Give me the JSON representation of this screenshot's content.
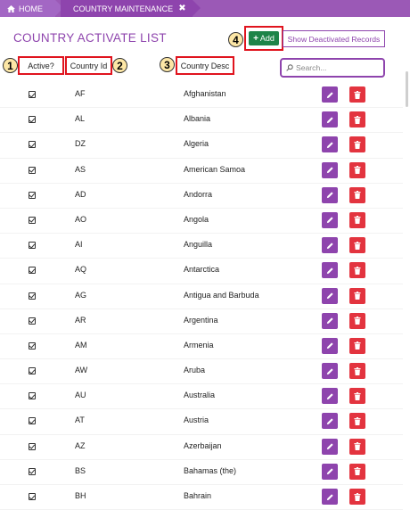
{
  "tabs": {
    "home_label": "HOME",
    "active_label": "COUNTRY MAINTENANCE",
    "close_glyph": "✖"
  },
  "page": {
    "title": "COUNTRY ACTIVATE LIST"
  },
  "toolbar": {
    "add_label": "Add",
    "add_icon": "plus-icon",
    "show_deactivated_label": "Show Deactivated Records"
  },
  "search": {
    "placeholder": "Search..."
  },
  "columns": {
    "active": "Active?",
    "country_id": "Country Id",
    "country_desc": "Country Desc"
  },
  "callouts": [
    "1",
    "2",
    "3",
    "4"
  ],
  "colors": {
    "brand_purple": "#8e44ad",
    "add_green": "#1e8449",
    "delete_red": "#e3343f",
    "highlight_red": "#e0141e"
  },
  "rows": [
    {
      "id": "AF",
      "desc": "Afghanistan",
      "active": true
    },
    {
      "id": "AL",
      "desc": "Albania",
      "active": true
    },
    {
      "id": "DZ",
      "desc": "Algeria",
      "active": true
    },
    {
      "id": "AS",
      "desc": "American Samoa",
      "active": true
    },
    {
      "id": "AD",
      "desc": "Andorra",
      "active": true
    },
    {
      "id": "AO",
      "desc": "Angola",
      "active": true
    },
    {
      "id": "AI",
      "desc": "Anguilla",
      "active": true
    },
    {
      "id": "AQ",
      "desc": "Antarctica",
      "active": true
    },
    {
      "id": "AG",
      "desc": "Antigua and Barbuda",
      "active": true
    },
    {
      "id": "AR",
      "desc": "Argentina",
      "active": true
    },
    {
      "id": "AM",
      "desc": "Armenia",
      "active": true
    },
    {
      "id": "AW",
      "desc": "Aruba",
      "active": true
    },
    {
      "id": "AU",
      "desc": "Australia",
      "active": true
    },
    {
      "id": "AT",
      "desc": "Austria",
      "active": true
    },
    {
      "id": "AZ",
      "desc": "Azerbaijan",
      "active": true
    },
    {
      "id": "BS",
      "desc": "Bahamas (the)",
      "active": true
    },
    {
      "id": "BH",
      "desc": "Bahrain",
      "active": true
    }
  ]
}
